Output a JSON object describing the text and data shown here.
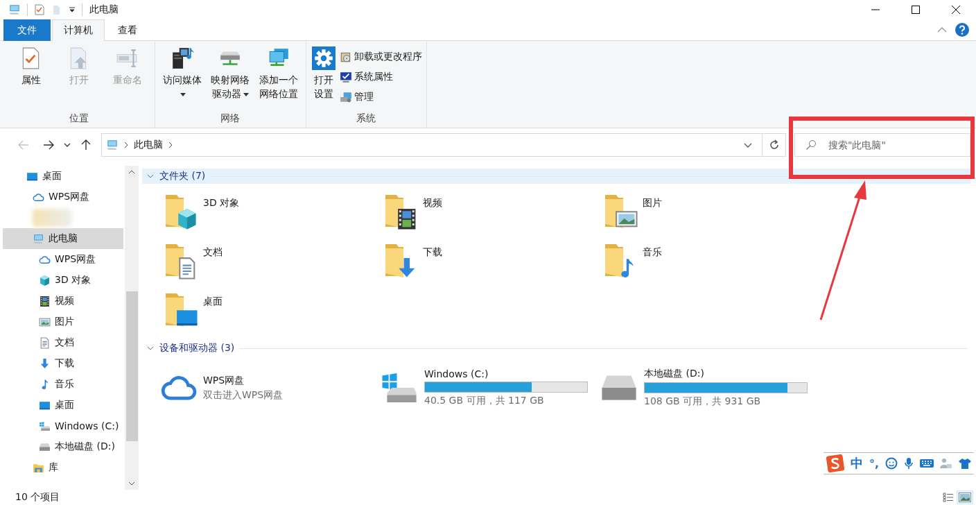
{
  "title_bar": {
    "title": "此电脑"
  },
  "ribbon_tabs": [
    {
      "label": "文件",
      "kind": "file",
      "selected": false
    },
    {
      "label": "计算机",
      "kind": "tab",
      "selected": true
    },
    {
      "label": "查看",
      "kind": "tab",
      "selected": false
    }
  ],
  "ribbon_groups": [
    {
      "label": "位置",
      "buttons": [
        {
          "label": "属性",
          "kind": "large",
          "disabled": false,
          "menu": false
        },
        {
          "label": "打开",
          "kind": "large",
          "disabled": true,
          "menu": false
        },
        {
          "label": "重命名",
          "kind": "large",
          "disabled": true,
          "menu": false
        }
      ]
    },
    {
      "label": "网络",
      "buttons": [
        {
          "label": "访问媒体",
          "kind": "large",
          "disabled": false,
          "menu": true
        },
        {
          "label": "映射网络驱动器",
          "kind": "large",
          "disabled": false,
          "menu": true
        },
        {
          "label": "添加一个网络位置",
          "kind": "large",
          "disabled": false,
          "menu": false
        }
      ]
    },
    {
      "label": "系统",
      "buttons": [
        {
          "label": "打开设置",
          "kind": "large",
          "disabled": false,
          "menu": false
        },
        {
          "label": "卸载或更改程序",
          "kind": "small",
          "disabled": false,
          "menu": false
        },
        {
          "label": "系统属性",
          "kind": "small",
          "disabled": false,
          "menu": false
        },
        {
          "label": "管理",
          "kind": "small",
          "disabled": false,
          "menu": false
        }
      ]
    }
  ],
  "navigation": {
    "back_enabled": false,
    "forward_enabled": true
  },
  "address_bar": {
    "path": [
      "此电脑"
    ]
  },
  "search": {
    "placeholder": "搜索\"此电脑\""
  },
  "nav_tree": [
    {
      "kind": "desktop",
      "label": "桌面",
      "selected": false,
      "children": [
        {
          "kind": "cloud",
          "label": "WPS网盘",
          "selected": false
        },
        {
          "kind": "redacted",
          "selected": false
        },
        {
          "kind": "computer",
          "label": "此电脑",
          "selected": true,
          "children": [
            {
              "kind": "cloud",
              "label": "WPS网盘",
              "selected": false
            },
            {
              "kind": "cube",
              "label": "3D 对象",
              "selected": false
            },
            {
              "kind": "film",
              "label": "视频",
              "selected": false
            },
            {
              "kind": "picture",
              "label": "图片",
              "selected": false
            },
            {
              "kind": "document",
              "label": "文档",
              "selected": false
            },
            {
              "kind": "download",
              "label": "下载",
              "selected": false
            },
            {
              "kind": "music",
              "label": "音乐",
              "selected": false
            },
            {
              "kind": "desktop",
              "label": "桌面",
              "selected": false
            },
            {
              "kind": "sysdrive",
              "label": "Windows (C:)",
              "selected": false
            },
            {
              "kind": "drive",
              "label": "本地磁盘 (D:)",
              "selected": false
            }
          ]
        },
        {
          "kind": "library",
          "label": "库",
          "selected": false
        }
      ]
    }
  ],
  "sections": [
    {
      "title": "文件夹 (7)",
      "kind": "folders",
      "expanded": true,
      "highlighted": true,
      "items": [
        {
          "kind": "cube",
          "label": "3D 对象"
        },
        {
          "kind": "film",
          "label": "视频"
        },
        {
          "kind": "picture",
          "label": "图片"
        },
        {
          "kind": "document",
          "label": "文档"
        },
        {
          "kind": "download",
          "label": "下载"
        },
        {
          "kind": "music",
          "label": "音乐"
        },
        {
          "kind": "desktop",
          "label": "桌面"
        }
      ]
    },
    {
      "title": "设备和驱动器 (3)",
      "kind": "devices",
      "expanded": true,
      "highlighted": false,
      "items": [
        {
          "kind": "cloud",
          "label": "WPS网盘",
          "subtitle": "双击进入WPS网盘"
        },
        {
          "kind": "sysdrive",
          "label": "Windows (C:)",
          "level": 0.66,
          "free": "40.5 GB 可用，共 117 GB"
        },
        {
          "kind": "drive",
          "label": "本地磁盘 (D:)",
          "level": 0.88,
          "free": "108 GB 可用，共 931 GB"
        }
      ]
    }
  ],
  "status_bar": {
    "count": "10 个项目"
  },
  "view_modes": [
    {
      "kind": "details",
      "selected": false
    },
    {
      "kind": "icons",
      "selected": true
    }
  ],
  "ime_bar": {
    "mode": "中",
    "punctuation": "°,"
  },
  "annotation": {
    "kind": "callout"
  }
}
